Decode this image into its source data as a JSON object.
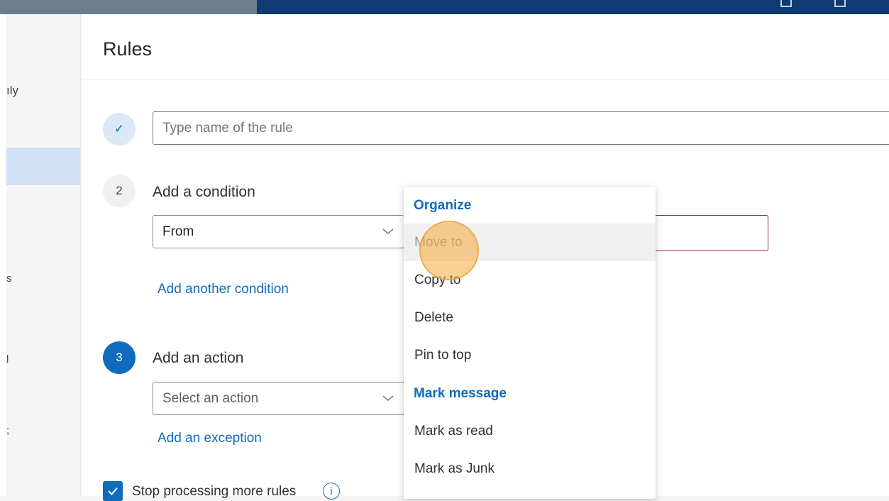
{
  "nav": {
    "fragments": [
      "ıly",
      "s",
      "ȷ",
      ";"
    ]
  },
  "page": {
    "title": "Rules"
  },
  "step1": {
    "rule_name_placeholder": "Type name of the rule",
    "check_glyph": "✓"
  },
  "step2": {
    "number": "2",
    "label": "Add a condition",
    "condition_selected": "From",
    "add_condition_link": "Add another condition"
  },
  "step3": {
    "number": "3",
    "label": "Add an action",
    "action_placeholder": "Select an action",
    "add_exception_link": "Add an exception"
  },
  "options": {
    "stop_processing_label": "Stop processing more rules",
    "stop_processing_checked": true,
    "info_glyph": "i"
  },
  "action_menu": {
    "groups": [
      {
        "header": "Organize",
        "items": [
          "Move to",
          "Copy to",
          "Delete",
          "Pin to top"
        ]
      },
      {
        "header": "Mark message",
        "items": [
          "Mark as read",
          "Mark as Junk"
        ]
      }
    ],
    "hovered_item": "Move to"
  },
  "colors": {
    "accent": "#0f6cbd",
    "topbar": "#0f3a74",
    "error_border": "#a4262c",
    "click_highlight": "#f5aa3c"
  }
}
